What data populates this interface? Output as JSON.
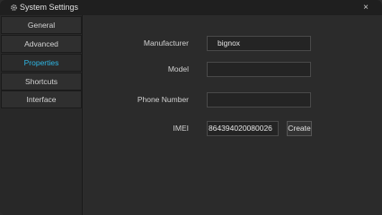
{
  "window": {
    "title": "System Settings",
    "close_glyph": "×",
    "icon": "gear-icon"
  },
  "sidebar": {
    "items": [
      {
        "label": "General"
      },
      {
        "label": "Advanced"
      },
      {
        "label": "Properties",
        "active": true
      },
      {
        "label": "Shortcuts"
      },
      {
        "label": "Interface"
      }
    ]
  },
  "properties": {
    "manufacturer": {
      "label": "Manufacturer",
      "value": "bignox"
    },
    "model": {
      "label": "Model",
      "value": ""
    },
    "phone_number": {
      "label": "Phone Number",
      "value": ""
    },
    "imei": {
      "label": "IMEI",
      "value": "864394020080026",
      "create_label": "Create"
    }
  },
  "colors": {
    "accent": "#2fb8e6",
    "background": "#2b2b2b",
    "titlebar": "#1f1f1f"
  }
}
